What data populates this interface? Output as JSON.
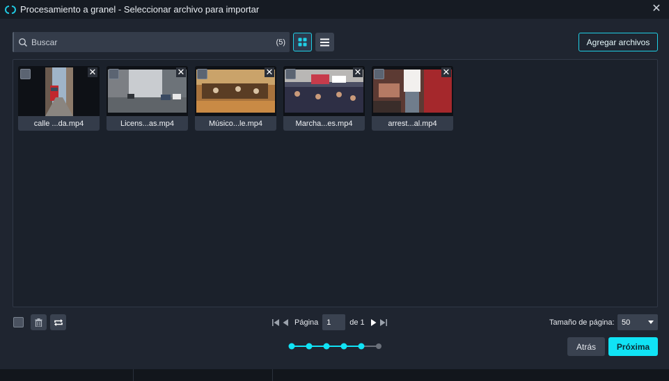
{
  "window": {
    "title": "Procesamiento a granel - Seleccionar archivo para importar",
    "close_icon": "close-icon"
  },
  "search": {
    "placeholder": "Buscar",
    "count": "(5)"
  },
  "toolbar": {
    "grid_view_icon": "grid-icon",
    "list_view_icon": "list-icon",
    "add_files_label": "Agregar archivos"
  },
  "files": [
    {
      "name": "calle ...da.mp4",
      "thumb": "street-tram",
      "checked": false
    },
    {
      "name": "Licens...as.mp4",
      "thumb": "city-street",
      "checked": false
    },
    {
      "name": "Músico...le.mp4",
      "thumb": "street-musicians",
      "checked": false
    },
    {
      "name": "Marcha...es.mp4",
      "thumb": "protest-march",
      "checked": false
    },
    {
      "name": "arrest...al.mp4",
      "thumb": "arrest-scene",
      "checked": false
    }
  ],
  "pagination": {
    "page_label": "Página",
    "current_page": "1",
    "of_label": "de 1",
    "page_size_label": "Tamaño de página:",
    "page_size": "50"
  },
  "stepper": {
    "total_steps": 6,
    "completed_steps": 5
  },
  "actions": {
    "back_label": "Atrás",
    "next_label": "Próxima"
  },
  "colors": {
    "accent": "#10e3f5",
    "background": "#1f2530",
    "panel": "#1b212b",
    "step_inactive": "#6b717b"
  }
}
